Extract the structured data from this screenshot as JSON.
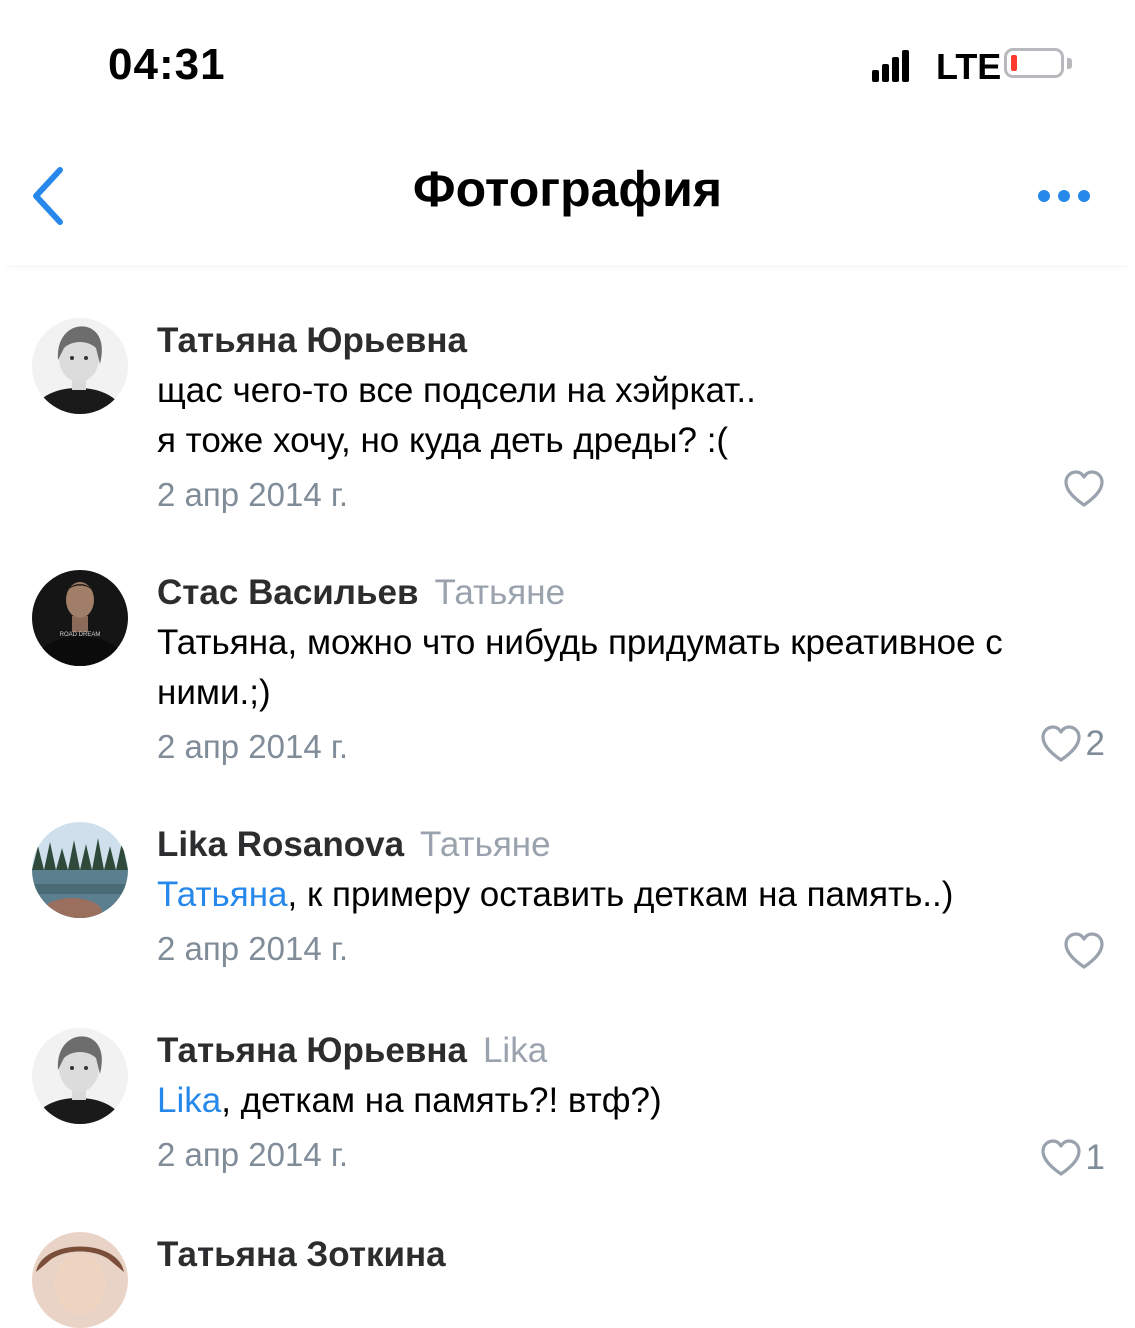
{
  "status_bar": {
    "time": "04:31",
    "network": "LTE"
  },
  "header": {
    "title": "Фотография"
  },
  "comments": [
    {
      "author": "Татьяна Юрьевна",
      "reply_to": "",
      "mention": "",
      "text_line1": "щас чего-то все подсели на хэйркат..",
      "text_line2": "я тоже хочу, но куда деть дреды? :(",
      "date": "2 апр 2014 г.",
      "likes": ""
    },
    {
      "author": "Стас Васильев",
      "reply_to": "Татьяне",
      "mention": "",
      "text_line1": "Татьяна, можно что нибудь придумать креативное с",
      "text_line2": "ними.;)",
      "date": "2 апр 2014 г.",
      "likes": "2",
      "avatar_shirt_text": "ROAD DREAM"
    },
    {
      "author": "Lika Rosanova",
      "reply_to": "Татьяне",
      "mention": "Татьяна",
      "text_line1": ", к примеру оставить деткам на память..)",
      "text_line2": "",
      "date": "2 апр 2014 г.",
      "likes": ""
    },
    {
      "author": "Татьяна Юрьевна",
      "reply_to": "Lika",
      "mention": "Lika",
      "text_line1": ", деткам на память?! втф?)",
      "text_line2": "",
      "date": "2 апр 2014 г.",
      "likes": "1"
    },
    {
      "author": "Татьяна Зоткина"
    }
  ],
  "colors": {
    "accent": "#2688eb",
    "secondary_text": "#818c99",
    "battery_low": "#ff3b30"
  },
  "icons": [
    "back-chevron-icon",
    "more-dots-icon",
    "heart-icon",
    "signal-icon",
    "battery-icon"
  ]
}
